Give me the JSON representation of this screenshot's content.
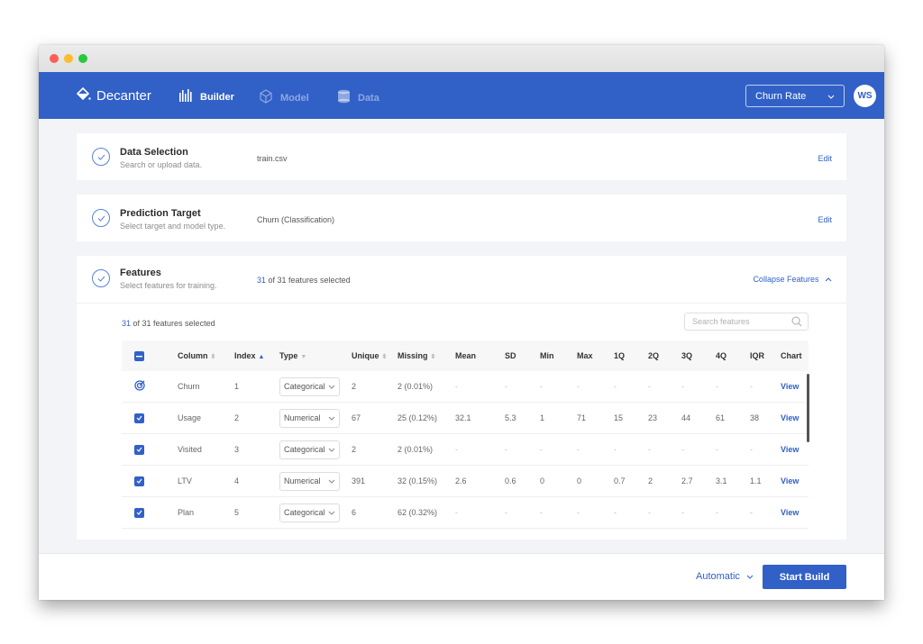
{
  "window": {
    "controls": [
      "close",
      "minimize",
      "maximize"
    ]
  },
  "navbar": {
    "brand": "Decanter",
    "items": [
      {
        "label": "Builder",
        "icon": "builder-icon",
        "active": true
      },
      {
        "label": "Model",
        "icon": "cube-icon",
        "active": false
      },
      {
        "label": "Data",
        "icon": "database-icon",
        "active": false
      }
    ],
    "target_select": "Churn Rate",
    "avatar": "WS"
  },
  "steps": {
    "data_selection": {
      "title": "Data Selection",
      "subtitle": "Search or upload data.",
      "value": "train.csv",
      "action": "Edit"
    },
    "prediction_target": {
      "title": "Prediction Target",
      "subtitle": "Select target and model type.",
      "value": "Churn (Classification)",
      "action": "Edit"
    },
    "features": {
      "title": "Features",
      "subtitle": "Select features for training.",
      "selected_count": "31",
      "selected_suffix": " of 31 features selected",
      "action": "Collapse Features"
    }
  },
  "features_panel": {
    "selected_count": "31",
    "selected_suffix": " of 31 features selected",
    "search_placeholder": "Search features",
    "columns": [
      "Column",
      "Index",
      "Type",
      "Unique",
      "Missing",
      "Mean",
      "SD",
      "Min",
      "Max",
      "1Q",
      "2Q",
      "3Q",
      "4Q",
      "IQR",
      "Chart"
    ],
    "rows": [
      {
        "marker": "target",
        "column": "Churn",
        "index": "1",
        "type": "Categorical",
        "unique": "2",
        "missing": "2 (0.01%)",
        "mean": "-",
        "sd": "-",
        "min": "-",
        "max": "-",
        "q1": "-",
        "q2": "-",
        "q3": "-",
        "q4": "-",
        "iqr": "-",
        "chart": "View"
      },
      {
        "marker": "checked",
        "column": "Usage",
        "index": "2",
        "type": "Numerical",
        "unique": "67",
        "missing": "25 (0.12%)",
        "mean": "32.1",
        "sd": "5.3",
        "min": "1",
        "max": "71",
        "q1": "15",
        "q2": "23",
        "q3": "44",
        "q4": "61",
        "iqr": "38",
        "chart": "View"
      },
      {
        "marker": "checked",
        "column": "Visited",
        "index": "3",
        "type": "Categorical",
        "unique": "2",
        "missing": "2  (0.01%)",
        "mean": "-",
        "sd": "-",
        "min": "-",
        "max": "-",
        "q1": "-",
        "q2": "-",
        "q3": "-",
        "q4": "-",
        "iqr": "-",
        "chart": "View"
      },
      {
        "marker": "checked",
        "column": "LTV",
        "index": "4",
        "type": "Numerical",
        "unique": "391",
        "missing": "32 (0.15%)",
        "mean": "2.6",
        "sd": "0.6",
        "min": "0",
        "max": "0",
        "q1": "0.7",
        "q2": "2",
        "q3": "2.7",
        "q4": "3.1",
        "iqr": "1.1",
        "chart": "View"
      },
      {
        "marker": "checked",
        "column": "Plan",
        "index": "5",
        "type": "Categorical",
        "unique": "6",
        "missing": "62 (0.32%)",
        "mean": "-",
        "sd": "-",
        "min": "-",
        "max": "-",
        "q1": "-",
        "q2": "-",
        "q3": "-",
        "q4": "-",
        "iqr": "-",
        "chart": "View"
      }
    ]
  },
  "footer": {
    "mode_select": "Automatic",
    "start_button": "Start Build"
  },
  "colors": {
    "brand": "#3160c7",
    "background": "#f3f4f7"
  }
}
